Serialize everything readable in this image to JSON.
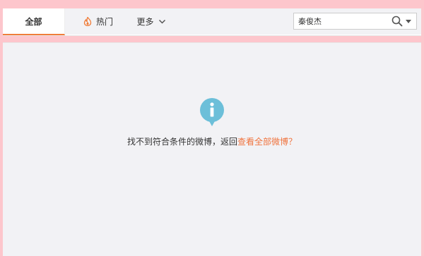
{
  "tabs": {
    "all_label": "全部",
    "hot_label": "热门",
    "more_label": "更多"
  },
  "search": {
    "value": "秦俊杰"
  },
  "empty_state": {
    "message": "找不到符合条件的微博，返回",
    "link_text": "查看全部微博？"
  },
  "colors": {
    "accent": "#f07d3a",
    "link": "#f0733d",
    "info_icon": "#6cbfd9"
  },
  "icons": [
    "fire-icon",
    "chevron-down-icon",
    "search-icon",
    "caret-down-icon",
    "info-icon"
  ]
}
